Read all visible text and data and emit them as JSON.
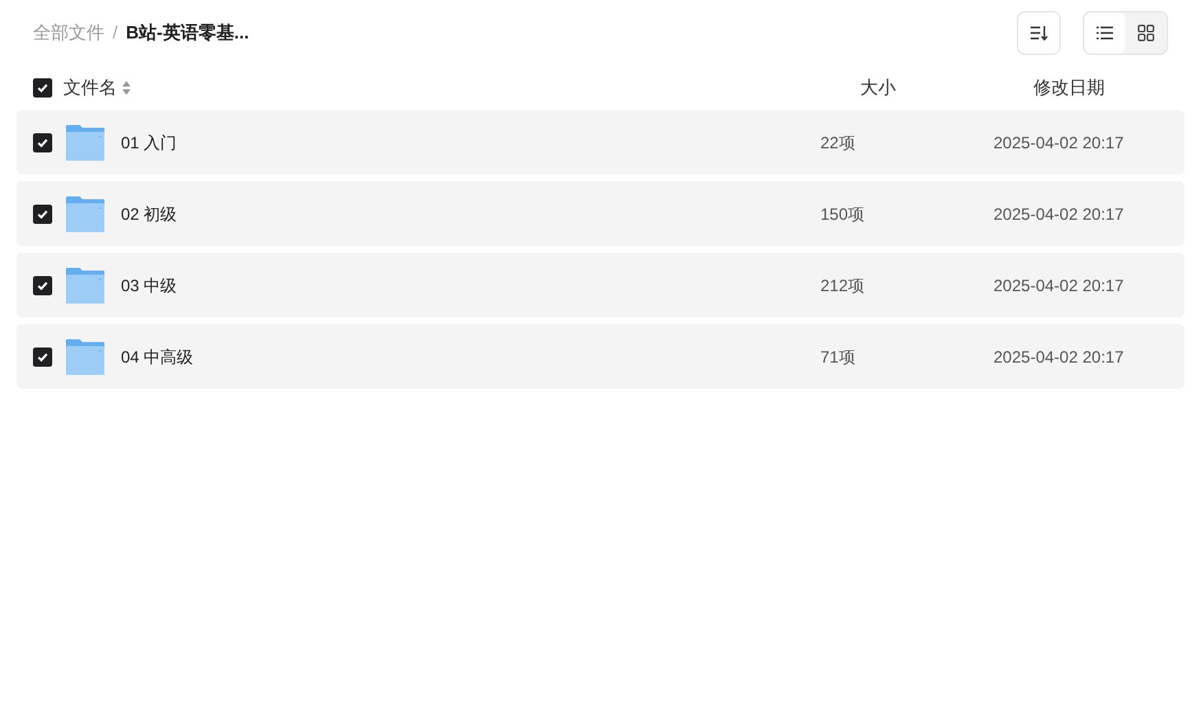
{
  "breadcrumb": [
    {
      "label": "全部文件",
      "current": false
    },
    {
      "label": "B站-英语零基...",
      "current": true
    }
  ],
  "breadcrumb_separator": "/",
  "view_toggle": [
    {
      "kind": "list",
      "selected": true
    },
    {
      "kind": "grid",
      "selected": false
    }
  ],
  "table": {
    "select_all": {
      "checked": true
    },
    "columns": [
      "文件名",
      "大小",
      "修改日期"
    ],
    "rows": [
      {
        "name": "01 入门",
        "size": "22项",
        "modified": "2025-04-02 20:17",
        "checked": true
      },
      {
        "name": "02 初级",
        "size": "150项",
        "modified": "2025-04-02 20:17",
        "checked": true
      },
      {
        "name": "03 中级",
        "size": "212项",
        "modified": "2025-04-02 20:17",
        "checked": true
      },
      {
        "name": "04 中高级",
        "size": "71项",
        "modified": "2025-04-02 20:17",
        "checked": true
      }
    ]
  }
}
